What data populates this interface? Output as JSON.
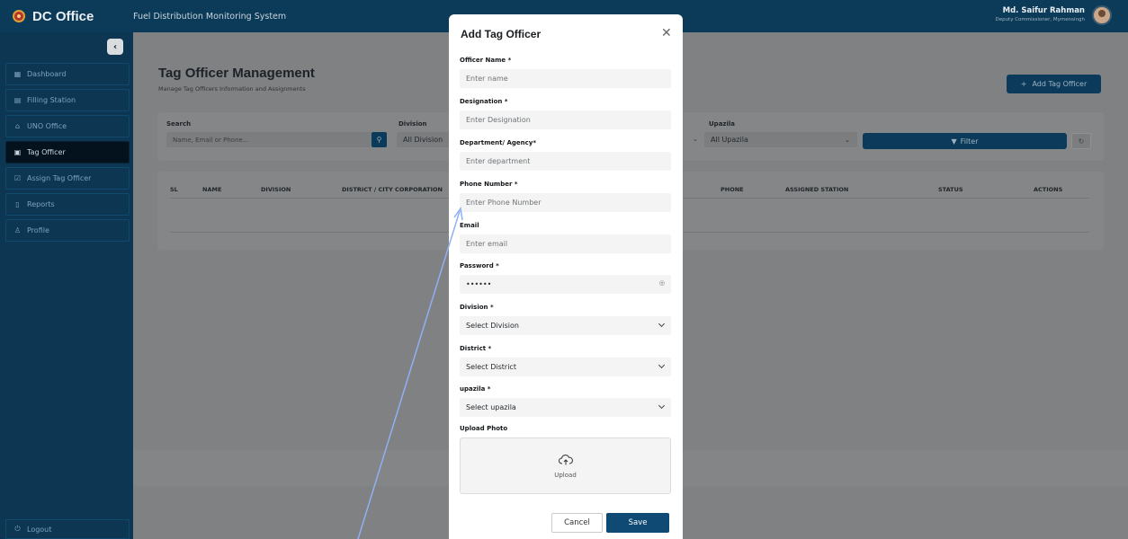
{
  "header": {
    "brand": "DC Office",
    "app_title": "Fuel Distribution Monitoring System",
    "user_name": "Md. Saifur Rahman",
    "user_role": "Deputy Commissioner, Mymensingh"
  },
  "sidebar": {
    "items": [
      {
        "label": "Dashboard",
        "icon": "dashboard-icon"
      },
      {
        "label": "Filling Station",
        "icon": "station-icon"
      },
      {
        "label": "UNO Office",
        "icon": "building-icon"
      },
      {
        "label": "Tag Officer",
        "icon": "id-card-icon"
      },
      {
        "label": "Assign Tag Officer",
        "icon": "check-square-icon"
      },
      {
        "label": "Reports",
        "icon": "document-icon"
      },
      {
        "label": "Profile",
        "icon": "user-icon"
      }
    ],
    "logout": "Logout"
  },
  "main": {
    "title": "Tag Officer Management",
    "subtitle": "Manage Tag Officers Information and Assignments",
    "add_button": "Add Tag Officer",
    "filters": {
      "search_label": "Search",
      "search_placeholder": "Name, Email or Phone...",
      "division_label": "Division",
      "division_value": "All Division",
      "upazila_label": "Upazila",
      "upazila_value": "All Upazila",
      "filter_button": "Filter"
    },
    "table_headers": [
      "SL",
      "NAME",
      "DIVISION",
      "DISTRICT / CITY CORPORATION",
      "PHONE",
      "ASSIGNED STATION",
      "STATUS",
      "ACTIONS"
    ]
  },
  "modal": {
    "title": "Add Tag Officer",
    "fields": {
      "officer_name": {
        "label": "Officer Name *",
        "placeholder": "Enter name"
      },
      "designation": {
        "label": "Designation *",
        "placeholder": "Enter Designation"
      },
      "department": {
        "label": "Department/ Agency*",
        "placeholder": "Enter department"
      },
      "phone": {
        "label": "Phone Number *",
        "placeholder": "Enter Phone Number"
      },
      "email": {
        "label": "Email",
        "placeholder": "Enter email"
      },
      "password": {
        "label": "Password *",
        "value": "••••••"
      },
      "division": {
        "label": "Division *",
        "value": "Select Division"
      },
      "district": {
        "label": "District *",
        "value": "Select District"
      },
      "upazila": {
        "label": "upazila *",
        "value": "Select upazila"
      },
      "upload": {
        "label": "Upload Photo",
        "text": "Upload"
      }
    },
    "cancel": "Cancel",
    "save": "Save"
  }
}
